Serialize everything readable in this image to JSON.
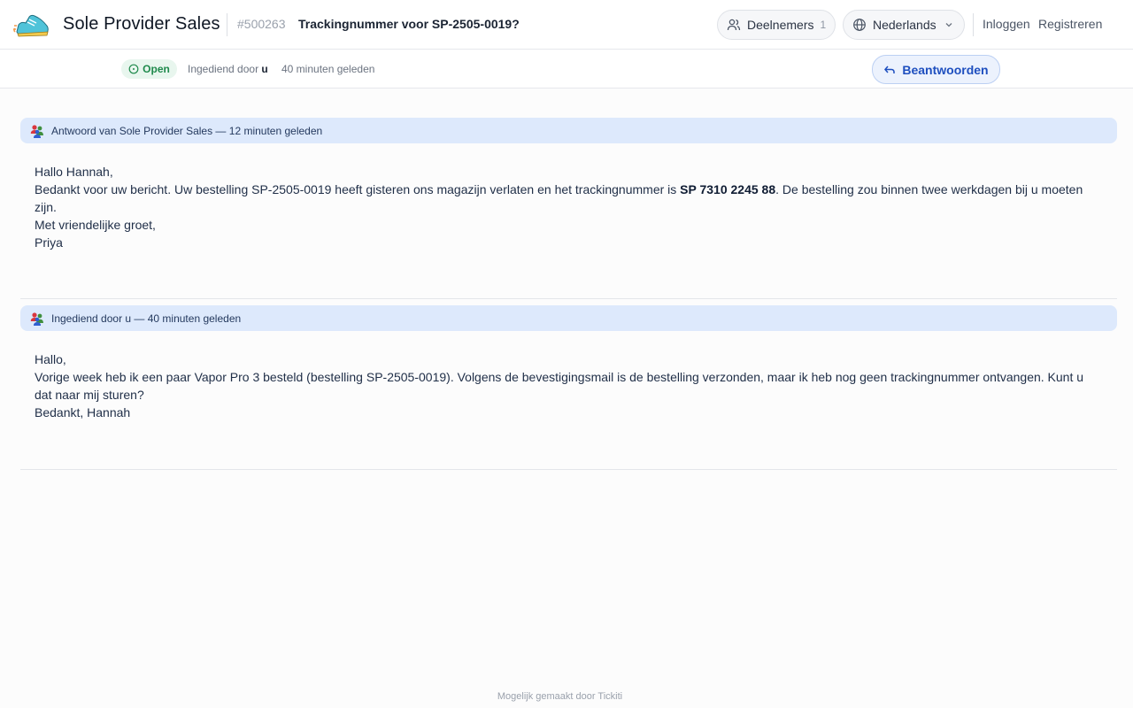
{
  "header": {
    "brand": "Sole Provider Sales",
    "ticket_number": "#500263",
    "ticket_title": "Trackingnummer voor SP-2505-0019?",
    "participants_label": "Deelnemers",
    "participants_count": "1",
    "language_label": "Nederlands",
    "login_label": "Inloggen",
    "register_label": "Registreren"
  },
  "status": {
    "badge": "Open",
    "submitted_prefix": "Ingediend door",
    "submitted_by": "u",
    "submitted_time": "40 minuten geleden",
    "reply_label": "Beantwoorden"
  },
  "messages": [
    {
      "header": "Antwoord van Sole Provider Sales — 12 minuten geleden",
      "greeting": "Hallo Hannah,",
      "line1_before": "Bedankt voor uw bericht. Uw bestelling SP-2505-0019 heeft gisteren ons magazijn verlaten en het trackingnummer is ",
      "tracking_number": "SP 7310 2245 88",
      "line1_after": ". De bestelling zou binnen twee werkdagen bij u moeten zijn.",
      "closing": "Met vriendelijke groet,",
      "signature": "Priya"
    },
    {
      "header": "Ingediend door u — 40 minuten geleden",
      "greeting": "Hallo,",
      "body": "Vorige week heb ik een paar Vapor Pro 3 besteld (bestelling SP-2505-0019). Volgens de bevestigingsmail is de bestelling verzonden, maar ik heb nog geen trackingnummer ontvangen. Kunt u dat naar mij sturen?",
      "closing": "Bedankt, Hannah"
    }
  ],
  "footer": {
    "text": "Mogelijk gemaakt door Tickiti"
  },
  "icons": {
    "logo": "sneaker-logo",
    "participants": "users-icon",
    "language": "globe-icon",
    "dropdown": "chevron-down-icon",
    "status": "clock-icon",
    "reply": "reply-arrow-icon",
    "message_author": "users-group-icon"
  },
  "colors": {
    "status_open": "#1f8a4c",
    "reply_accent": "#1e4fbf",
    "message_header_bg": "#dde9fc"
  }
}
